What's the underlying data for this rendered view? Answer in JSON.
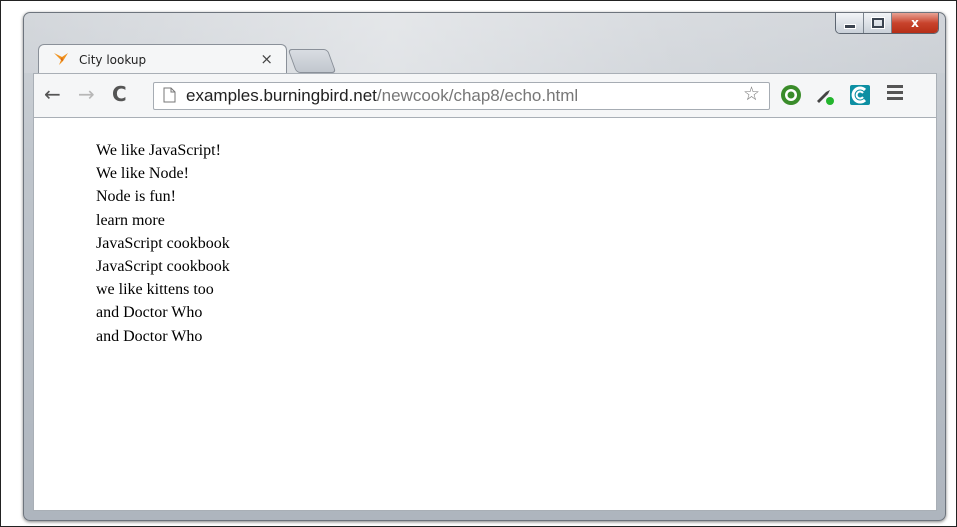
{
  "window_controls": {
    "close_label": "x"
  },
  "tab": {
    "title": "City lookup",
    "close_label": "×"
  },
  "toolbar": {
    "back_glyph": "←",
    "forward_glyph": "→",
    "reload_glyph": "C",
    "url_host": "examples.burningbird.net",
    "url_path": "/newcook/chap8/echo.html",
    "star_glyph": "☆"
  },
  "content": {
    "lines": [
      "We like JavaScript!",
      "We like Node!",
      "Node is fun!",
      "learn more",
      "JavaScript cookbook",
      "JavaScript cookbook",
      "we like kittens too",
      "and Doctor Who",
      "and Doctor Who"
    ]
  },
  "colors": {
    "frame": "#aeb5be",
    "toolbar": "#f5f6f7",
    "close": "#c8432c"
  }
}
